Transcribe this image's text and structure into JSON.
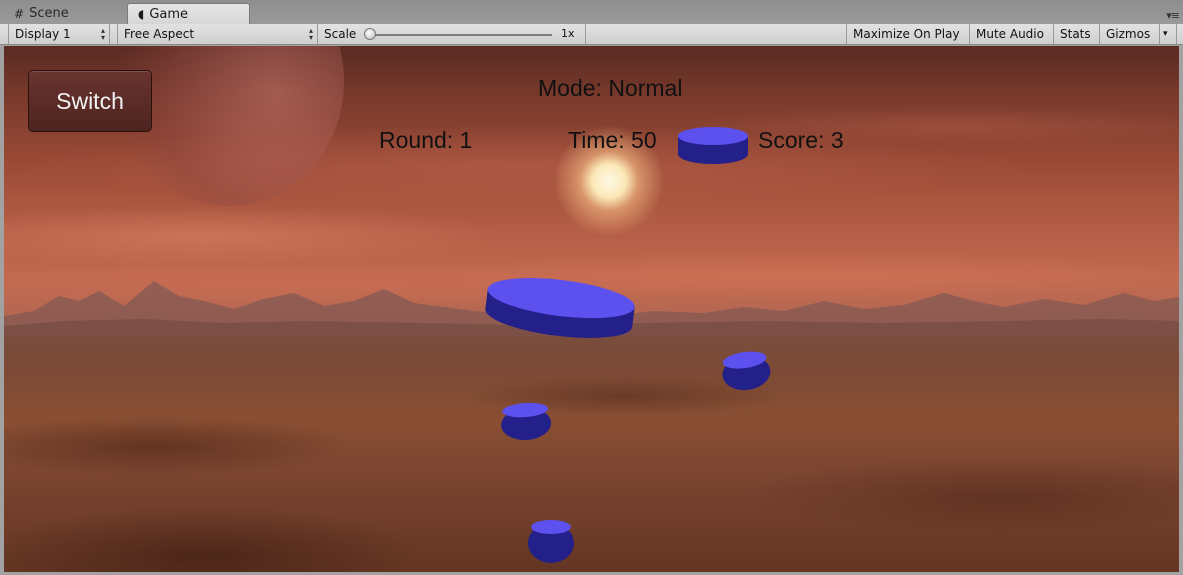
{
  "tabs": {
    "scene_label": "Scene",
    "game_label": "Game"
  },
  "toolbar": {
    "display": "Display 1",
    "aspect": "Free Aspect",
    "scale_label": "Scale",
    "scale_value": "1x",
    "maximize_on_play": "Maximize On Play",
    "mute_audio": "Mute Audio",
    "stats": "Stats",
    "gizmos": "Gizmos"
  },
  "game": {
    "switch_label": "Switch",
    "mode": "Mode: Normal",
    "round": "Round: 1",
    "time": "Time: 50",
    "score": "Score: 3"
  },
  "colors": {
    "disc_top": "#5c50ee",
    "disc_side": "#24208a",
    "disc_dark": "#16125e"
  }
}
